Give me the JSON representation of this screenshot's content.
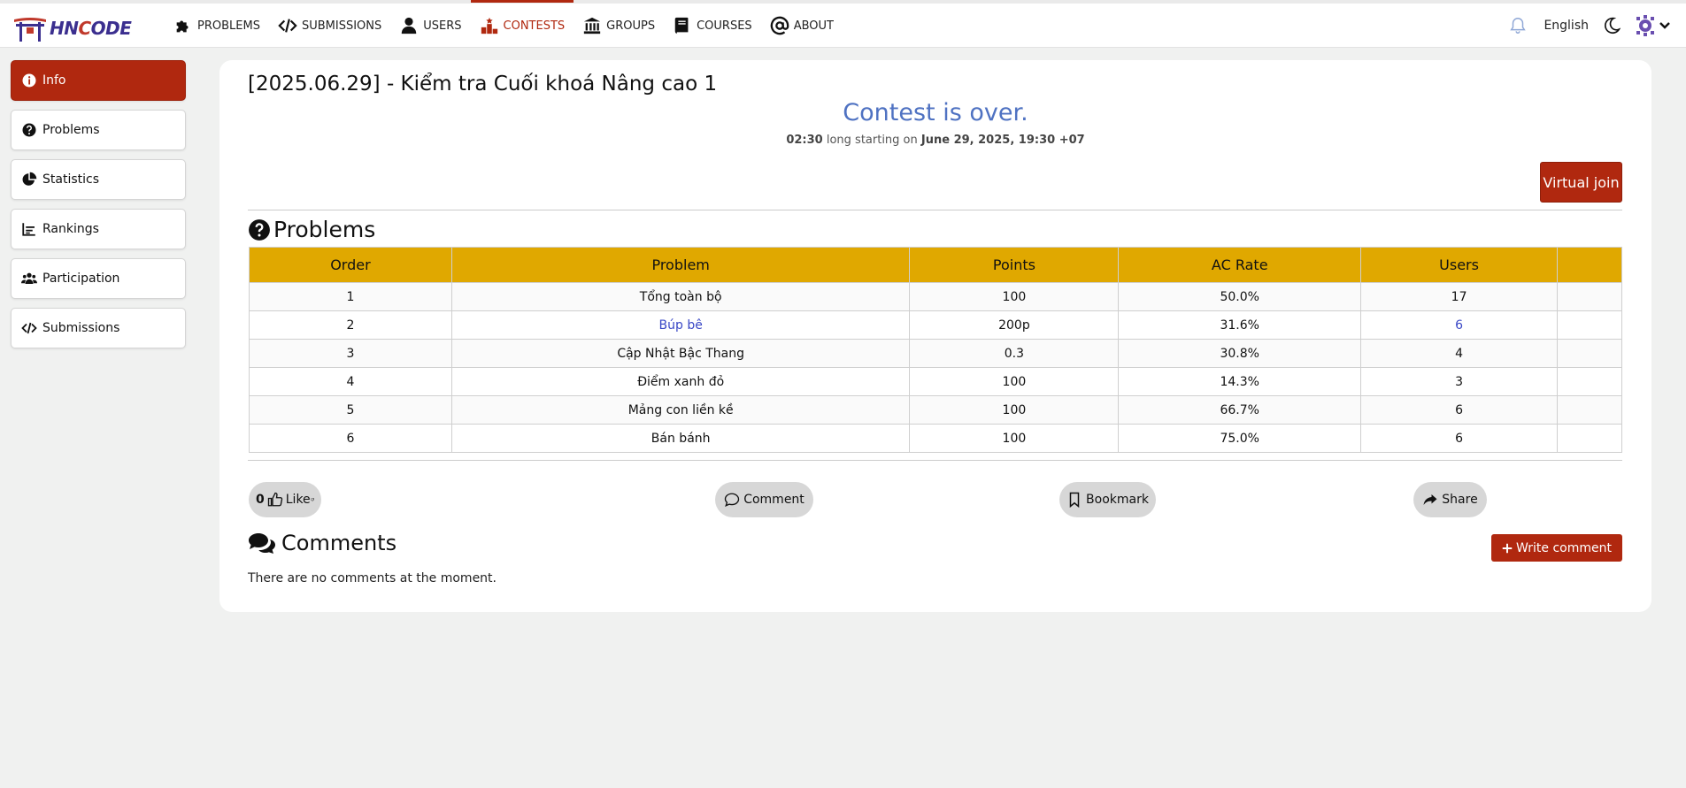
{
  "app": {
    "brand_prefix": "HN",
    "brand_o": "C",
    "brand_suffix": "ODE"
  },
  "nav": {
    "items": [
      {
        "label": "PROBLEMS",
        "icon": "puzzle-icon"
      },
      {
        "label": "SUBMISSIONS",
        "icon": "code-icon"
      },
      {
        "label": "USERS",
        "icon": "user-icon"
      },
      {
        "label": "CONTESTS",
        "icon": "podium-icon",
        "active": true
      },
      {
        "label": "GROUPS",
        "icon": "institution-icon"
      },
      {
        "label": "COURSES",
        "icon": "book-icon"
      },
      {
        "label": "ABOUT",
        "icon": "at-icon"
      }
    ],
    "language": "English"
  },
  "sidebar": {
    "items": [
      {
        "label": "Info",
        "icon": "info-icon",
        "active": true
      },
      {
        "label": "Problems",
        "icon": "question-icon"
      },
      {
        "label": "Statistics",
        "icon": "pie-chart-icon"
      },
      {
        "label": "Rankings",
        "icon": "chart-icon"
      },
      {
        "label": "Participation",
        "icon": "users-icon"
      },
      {
        "label": "Submissions",
        "icon": "code-icon"
      }
    ]
  },
  "contest": {
    "title": "[2025.06.29] - Kiểm tra Cuối khoá Nâng cao 1",
    "status": "Contest is over.",
    "duration": "02:30",
    "duration_text": " long starting on ",
    "start": "June 29, 2025, 19:30 +07",
    "virtual_join": "Virtual join"
  },
  "problems": {
    "heading": "Problems",
    "columns": [
      "Order",
      "Problem",
      "Points",
      "AC Rate",
      "Users",
      ""
    ],
    "rows": [
      [
        "1",
        "Tổng toàn bộ",
        "100",
        "50.0%",
        "17",
        ""
      ],
      [
        "2",
        "Búp bê",
        "200p",
        "31.6%",
        "6",
        ""
      ],
      [
        "3",
        "Cập Nhật Bậc Thang",
        "0.3",
        "30.8%",
        "4",
        ""
      ],
      [
        "4",
        "Điểm xanh đỏ",
        "100",
        "14.3%",
        "3",
        ""
      ],
      [
        "5",
        "Mảng con liền kề",
        "100",
        "66.7%",
        "6",
        ""
      ],
      [
        "6",
        "Bán bánh",
        "100",
        "75.0%",
        "6",
        ""
      ]
    ]
  },
  "actions": {
    "like_count": "0",
    "like_label": "Like",
    "comment_label": "Comment",
    "bookmark_label": "Bookmark",
    "share_label": "Share"
  },
  "comments": {
    "heading": "Comments",
    "write_label": "Write comment",
    "empty": "There are no comments at the moment."
  },
  "colors": {
    "accent": "#b0280f",
    "table_header": "#e0a800",
    "status_blue": "#4f72c2",
    "link": "#3a48c6"
  }
}
